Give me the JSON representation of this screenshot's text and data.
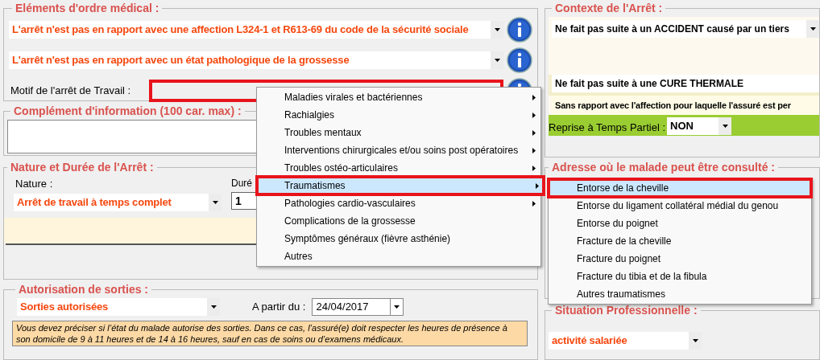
{
  "medical": {
    "legend": "Eléments d'ordre médical :",
    "dropdowns": [
      {
        "value": "L'arrêt n'est pas en rapport avec une affection L324-1 et R613-69 du code de la sécurité sociale"
      },
      {
        "value": "L'arrêt n'est pas en rapport avec un état pathologique de la grossesse"
      }
    ],
    "motif": {
      "label": "Motif de l'arrêt de Travail :",
      "highlighted": true
    }
  },
  "complement": {
    "legend": "Complément d'information (100 car. max) :"
  },
  "nature": {
    "legend": "Nature et Durée de l'Arrêt :",
    "nature_label": "Nature :",
    "nature_value": "Arrêt de travail à temps complet",
    "duration_label": "Duré",
    "duration_value": "1"
  },
  "sorties": {
    "legend": "Autorisation de sorties :",
    "value": "Sorties autorisées",
    "date_label": "A partir du :",
    "date_value": "24/04/2017",
    "note": "Vous devez préciser si l’état du malade autorise des sorties. Dans ce cas, l’assuré(e) doit respecter les heures de présence à son domicile  de 9 à 11 heures et de 14 à 16 heures, sauf en cas de soins ou d’examens médicaux."
  },
  "contexte": {
    "legend": "Contexte de l'Arrêt :",
    "accident": "Ne fait pas suite à un ACCIDENT causé par un tiers",
    "cure": "Ne fait pas suite à une CURE THERMALE",
    "affection": "Sans rapport avec l'affection pour laquelle l'assuré est per",
    "partial_label": "Reprise à Temps Partiel :",
    "partial_value": "NON"
  },
  "adresse": {
    "legend": "Adresse où le malade peut être consulté :"
  },
  "situation": {
    "legend": "Situation Professionnelle :",
    "value": "activité salariée"
  },
  "menu": [
    {
      "label": "Maladies virales et bactériennes",
      "submenu": true,
      "selected": false,
      "highlighted": false
    },
    {
      "label": "Rachialgies",
      "submenu": true,
      "selected": false,
      "highlighted": false
    },
    {
      "label": "Troubles mentaux",
      "submenu": true,
      "selected": false,
      "highlighted": false
    },
    {
      "label": "Interventions chirurgicales et/ou soins post opératoires",
      "submenu": true,
      "selected": false,
      "highlighted": false
    },
    {
      "label": "Troubles ostéo-articulaires",
      "submenu": true,
      "selected": false,
      "highlighted": false
    },
    {
      "label": "Traumatismes",
      "submenu": true,
      "selected": true,
      "highlighted": true
    },
    {
      "label": "Pathologies cardio-vasculaires",
      "submenu": true,
      "selected": false,
      "highlighted": false
    },
    {
      "label": "Complications de la grossesse",
      "submenu": false,
      "selected": false,
      "highlighted": false
    },
    {
      "label": "Symptômes généraux (fièvre asthénie)",
      "submenu": false,
      "selected": false,
      "highlighted": false
    },
    {
      "label": "Autres",
      "submenu": false,
      "selected": false,
      "highlighted": false
    }
  ],
  "submenu": [
    {
      "label": "Entorse de la cheville",
      "selected": true,
      "highlighted": true
    },
    {
      "label": "Entorse du ligament collatéral médial du genou",
      "selected": false,
      "highlighted": false
    },
    {
      "label": "Entorse du poignet",
      "selected": false,
      "highlighted": false
    },
    {
      "label": "Fracture de la cheville",
      "selected": false,
      "highlighted": false
    },
    {
      "label": "Fracture du poignet",
      "selected": false,
      "highlighted": false
    },
    {
      "label": "Fracture du tibia et de la fibula",
      "selected": false,
      "highlighted": false
    },
    {
      "label": "Autres traumatismes",
      "selected": false,
      "highlighted": false
    }
  ]
}
